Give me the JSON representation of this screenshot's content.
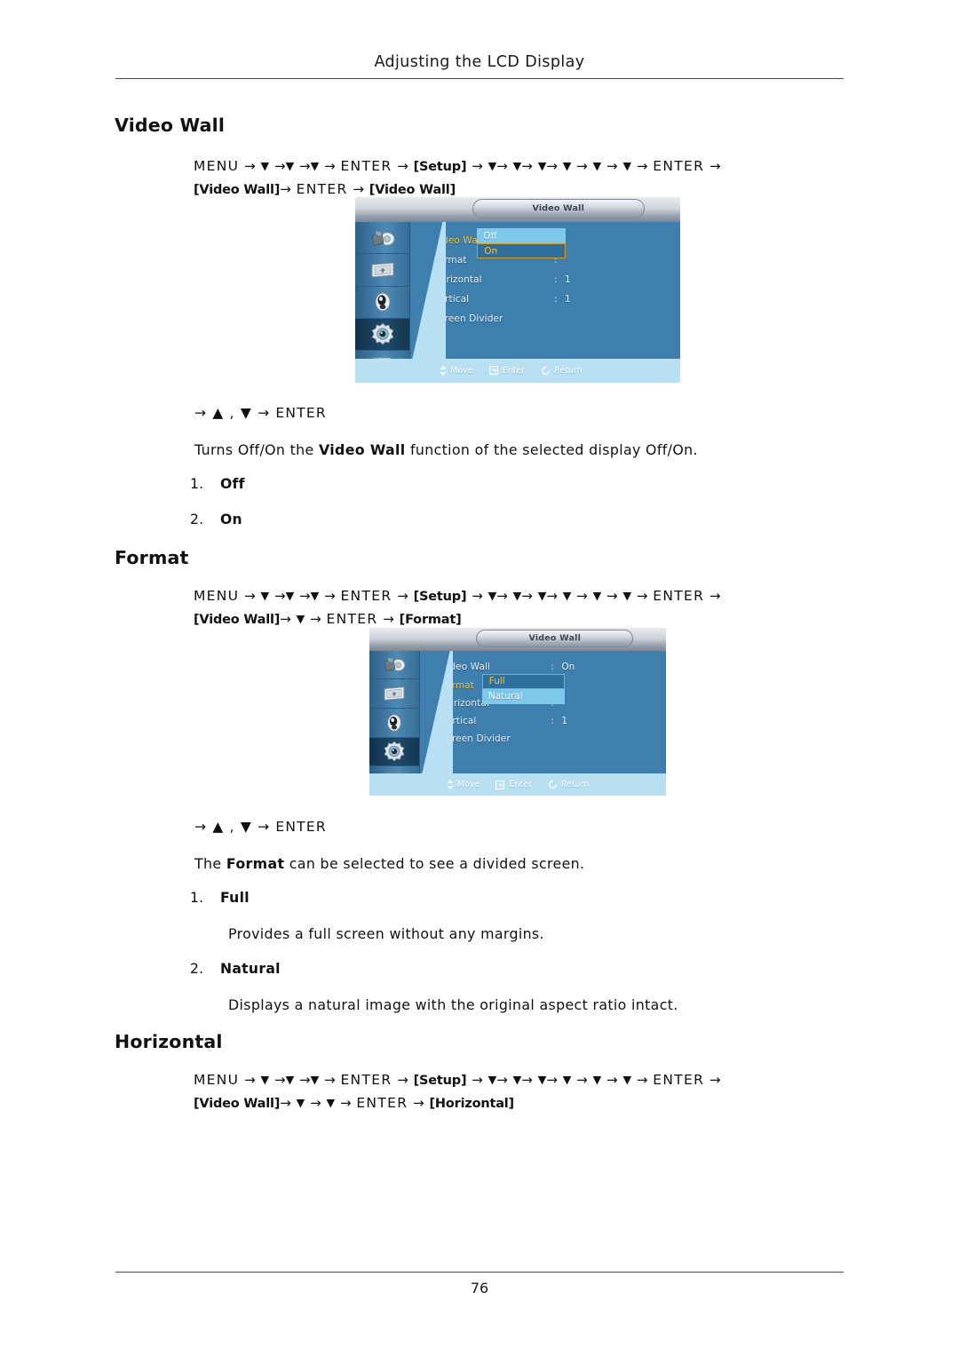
{
  "header": {
    "title": "Adjusting the LCD Display"
  },
  "footer": {
    "page_number": "76"
  },
  "sections": [
    {
      "heading": "Video Wall",
      "path_line1_prefix": "MENU",
      "path_tag_setup": "[Setup]",
      "path_enter": "ENTER",
      "path_line2_tag": "[Video Wall]",
      "path_line2_end_tag": "[Video Wall]",
      "key_hint": "→ ▲ , ▼ → ENTER",
      "description_pre": "Turns Off/On the ",
      "description_bold": "Video Wall",
      "description_post": " function of the selected display Off/On.",
      "options": [
        {
          "num": "1.",
          "label": "Off",
          "detail": ""
        },
        {
          "num": "2.",
          "label": "On",
          "detail": ""
        }
      ]
    },
    {
      "heading": "Format",
      "path_line2_end_tag": "[Format]",
      "key_hint": "→ ▲ , ▼ → ENTER",
      "description_pre": "The ",
      "description_bold": "Format",
      "description_post": " can be selected to see a divided screen.",
      "options": [
        {
          "num": "1.",
          "label": "Full",
          "detail": "Provides a full screen without any margins."
        },
        {
          "num": "2.",
          "label": "Natural",
          "detail": "Displays a natural image with the original aspect ratio intact."
        }
      ]
    },
    {
      "heading": "Horizontal",
      "path_line2_end_tag": "[Horizontal]"
    }
  ],
  "osd_common": {
    "title": "Video Wall",
    "footer_items": [
      {
        "icon": "updown-arrows-icon",
        "label": "Move"
      },
      {
        "icon": "enter-key-icon",
        "label": "Enter"
      },
      {
        "icon": "return-arrow-icon",
        "label": "Return"
      }
    ],
    "sidebar_icons": [
      "picture-icon",
      "screen-icon",
      "sound-icon",
      "setup-gear-icon",
      "multi-control-icon"
    ]
  },
  "osd_videowall": {
    "title": "Video Wall",
    "rows": [
      {
        "label": "Video Wall",
        "value": "",
        "selected": true,
        "has_colon": true
      },
      {
        "label": "Format",
        "value": "",
        "selected": false,
        "has_colon": true
      },
      {
        "label": "Horizontal",
        "value": "1",
        "selected": false,
        "has_colon": true
      },
      {
        "label": "Vertical",
        "value": "1",
        "selected": false,
        "has_colon": true
      },
      {
        "label": "Screen Divider",
        "value": "",
        "selected": false,
        "has_colon": false
      }
    ],
    "dropdown": {
      "options": [
        {
          "label": "Off",
          "state": "plain"
        },
        {
          "label": "On",
          "state": "focused"
        }
      ]
    }
  },
  "osd_format": {
    "title": "Video Wall",
    "rows": [
      {
        "label": "Video Wall",
        "value": "On",
        "selected": false,
        "has_colon": true
      },
      {
        "label": "Format",
        "value": "",
        "selected": true,
        "has_colon": true
      },
      {
        "label": "Horizontal",
        "value": "",
        "selected": false,
        "has_colon": true
      },
      {
        "label": "Vertical",
        "value": "1",
        "selected": false,
        "has_colon": true
      },
      {
        "label": "Screen Divider",
        "value": "",
        "selected": false,
        "has_colon": false
      }
    ],
    "dropdown": {
      "options": [
        {
          "label": "Full",
          "state": "focused"
        },
        {
          "label": "Natural",
          "state": "plain"
        }
      ]
    }
  },
  "colors": {
    "osd_body_blue": "#3e7fae",
    "osd_highlight_yellow": "#f2c23c",
    "osd_option_lightblue": "#7ec8ea",
    "osd_focus_border": "#d79b2a",
    "osd_footer_bg": "#b9e0f2",
    "rule_gray": "#4a4a4a"
  }
}
